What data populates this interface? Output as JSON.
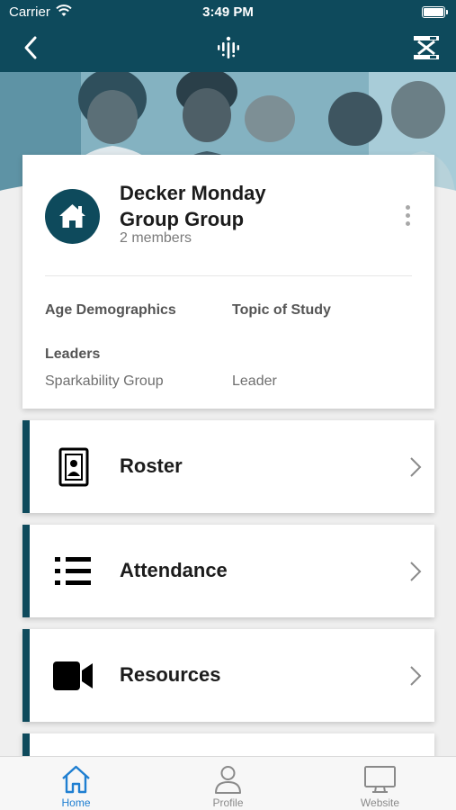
{
  "status_bar": {
    "carrier": "Carrier",
    "time": "3:49 PM"
  },
  "colors": {
    "brand": "#0e4a5c",
    "accent_tab": "#1f7fd1"
  },
  "nav_bar": {
    "back_icon": "chevron-left-icon",
    "logo_icon": "app-logo-icon",
    "menu_icon": "menu-icon"
  },
  "group": {
    "title_line1": "Decker Monday",
    "title_line2": "Group Group",
    "members": "2 members",
    "avatar_icon": "home-icon"
  },
  "details": {
    "age_label": "Age Demographics",
    "topic_label": "Topic of Study",
    "leaders_label": "Leaders",
    "leader_name": "Sparkability Group",
    "leader_role": "Leader"
  },
  "menu": [
    {
      "label": "Roster",
      "icon": "id-badge-icon"
    },
    {
      "label": "Attendance",
      "icon": "list-icon"
    },
    {
      "label": "Resources",
      "icon": "video-camera-icon"
    }
  ],
  "tabs": [
    {
      "label": "Home",
      "icon": "home-icon",
      "active": true
    },
    {
      "label": "Profile",
      "icon": "person-icon",
      "active": false
    },
    {
      "label": "Website",
      "icon": "monitor-icon",
      "active": false
    }
  ]
}
